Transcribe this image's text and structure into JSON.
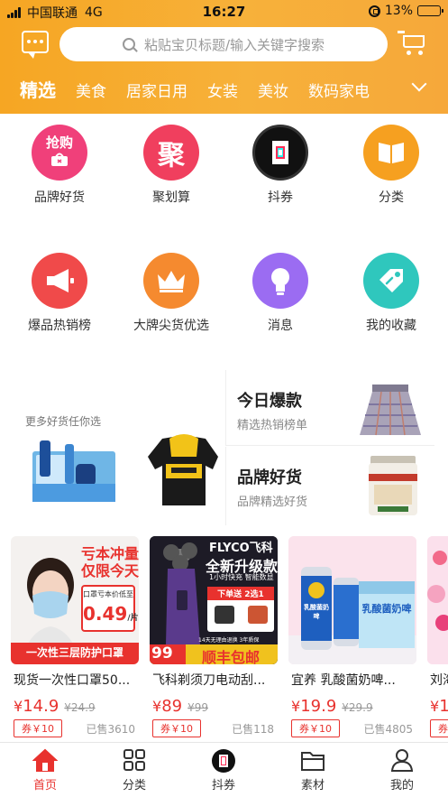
{
  "status_bar": {
    "carrier": "中国联通",
    "network": "4G",
    "time": "16:27",
    "battery": "13%",
    "battery_level": 0.13
  },
  "header": {
    "search_placeholder": "粘贴宝贝标题/输入关键字搜索",
    "categories": [
      "精选",
      "美食",
      "居家日用",
      "女装",
      "美妆",
      "数码家电"
    ],
    "active_category": "精选"
  },
  "grid": [
    {
      "label": "品牌好货",
      "icon": "rush-buy-bag-icon",
      "glyph": "抢购",
      "color": "#f0407a"
    },
    {
      "label": "聚划算",
      "icon": "juhuasuan-icon",
      "glyph": "聚",
      "color": "#f03f5e"
    },
    {
      "label": "抖券",
      "icon": "douyin-icon",
      "color": "#111111"
    },
    {
      "label": "分类",
      "icon": "book-icon",
      "color": "#f6a020"
    },
    {
      "label": "爆品热销榜",
      "icon": "megaphone-icon",
      "color": "#f04a4a"
    },
    {
      "label": "大牌尖货优选",
      "icon": "crown-icon",
      "color": "#f58a2f"
    },
    {
      "label": "消息",
      "icon": "lightbulb-icon",
      "color": "#9b6cf2"
    },
    {
      "label": "我的收藏",
      "icon": "tag-icon",
      "color": "#2fc7bd"
    }
  ],
  "promo": {
    "left_subtitle": "更多好货任你选",
    "right_top": {
      "title": "今日爆款",
      "desc": "精选热销榜单"
    },
    "right_bottom": {
      "title": "品牌好货",
      "desc": "品牌精选好货"
    }
  },
  "products": [
    {
      "title": "现货一次性口罩50...",
      "price": "14.9",
      "orig": "¥24.9",
      "coupon": "券￥10",
      "sold": "已售3610",
      "thumb": {
        "line1": "亏本冲量",
        "line2": "仅限今天",
        "tag": "口罩亏本价低至",
        "amount": "0.49",
        "unit": "/片",
        "footer": "一次性三层防护口罩"
      }
    },
    {
      "title": "飞科剃须刀电动刮...",
      "price": "89",
      "orig": "¥99",
      "coupon": "券￥10",
      "sold": "已售118",
      "thumb": {
        "brand": "FLYCO飞科",
        "line1": "全新升级款",
        "line2": "1小时快充 智能数显",
        "tag": "下单送 2选1",
        "bottom_price": "99",
        "bottom_tag": "顺丰包邮",
        "bottom_small": "14天无理由退换  3年质保"
      }
    },
    {
      "title": "宜养 乳酸菌奶啤...",
      "price": "19.9",
      "orig": "¥29.9",
      "coupon": "券￥10",
      "sold": "已售4805",
      "thumb": {
        "can_text": "乳酸菌奶啤",
        "box_text": "乳酸菌奶啤"
      }
    },
    {
      "title": "刘海",
      "price": "1",
      "coupon": "券",
      "thumb": {}
    }
  ],
  "tabbar": [
    {
      "label": "首页",
      "icon": "home-icon",
      "active": true
    },
    {
      "label": "分类",
      "icon": "grid-icon",
      "active": false
    },
    {
      "label": "抖券",
      "icon": "douyin-icon",
      "active": false
    },
    {
      "label": "素材",
      "icon": "folder-icon",
      "active": false
    },
    {
      "label": "我的",
      "icon": "person-icon",
      "active": false
    }
  ],
  "colors": {
    "brand_orange": "#f6a623",
    "price_red": "#e8322e"
  }
}
